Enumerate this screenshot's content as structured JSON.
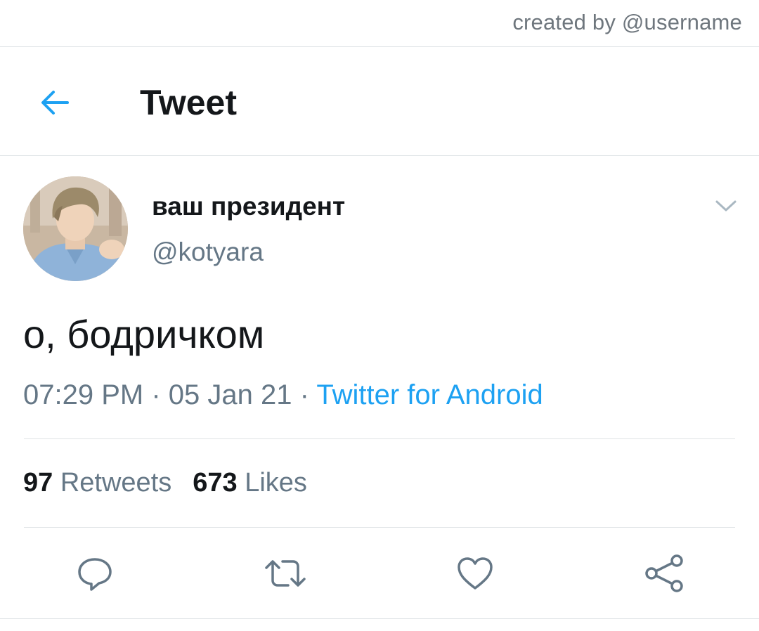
{
  "watermark": "created by @username",
  "header": {
    "title": "Tweet",
    "back_icon": "arrow-left-icon"
  },
  "author": {
    "display_name": "ваш президент",
    "handle": "@kotyara",
    "avatar": "avatar-photo"
  },
  "tweet": {
    "text": "о, бодричком",
    "time": "07:29 PM",
    "separator": "·",
    "date": "05 Jan 21",
    "source": "Twitter for Android"
  },
  "stats": {
    "retweets_count": "97",
    "retweets_label": "Retweets",
    "likes_count": "673",
    "likes_label": "Likes"
  },
  "actions": [
    "reply-icon",
    "retweet-icon",
    "like-icon",
    "share-icon"
  ],
  "colors": {
    "accent": "#1da1f2",
    "text_primary": "#14171a",
    "text_secondary": "#657786",
    "divider": "#dfe3e6"
  }
}
